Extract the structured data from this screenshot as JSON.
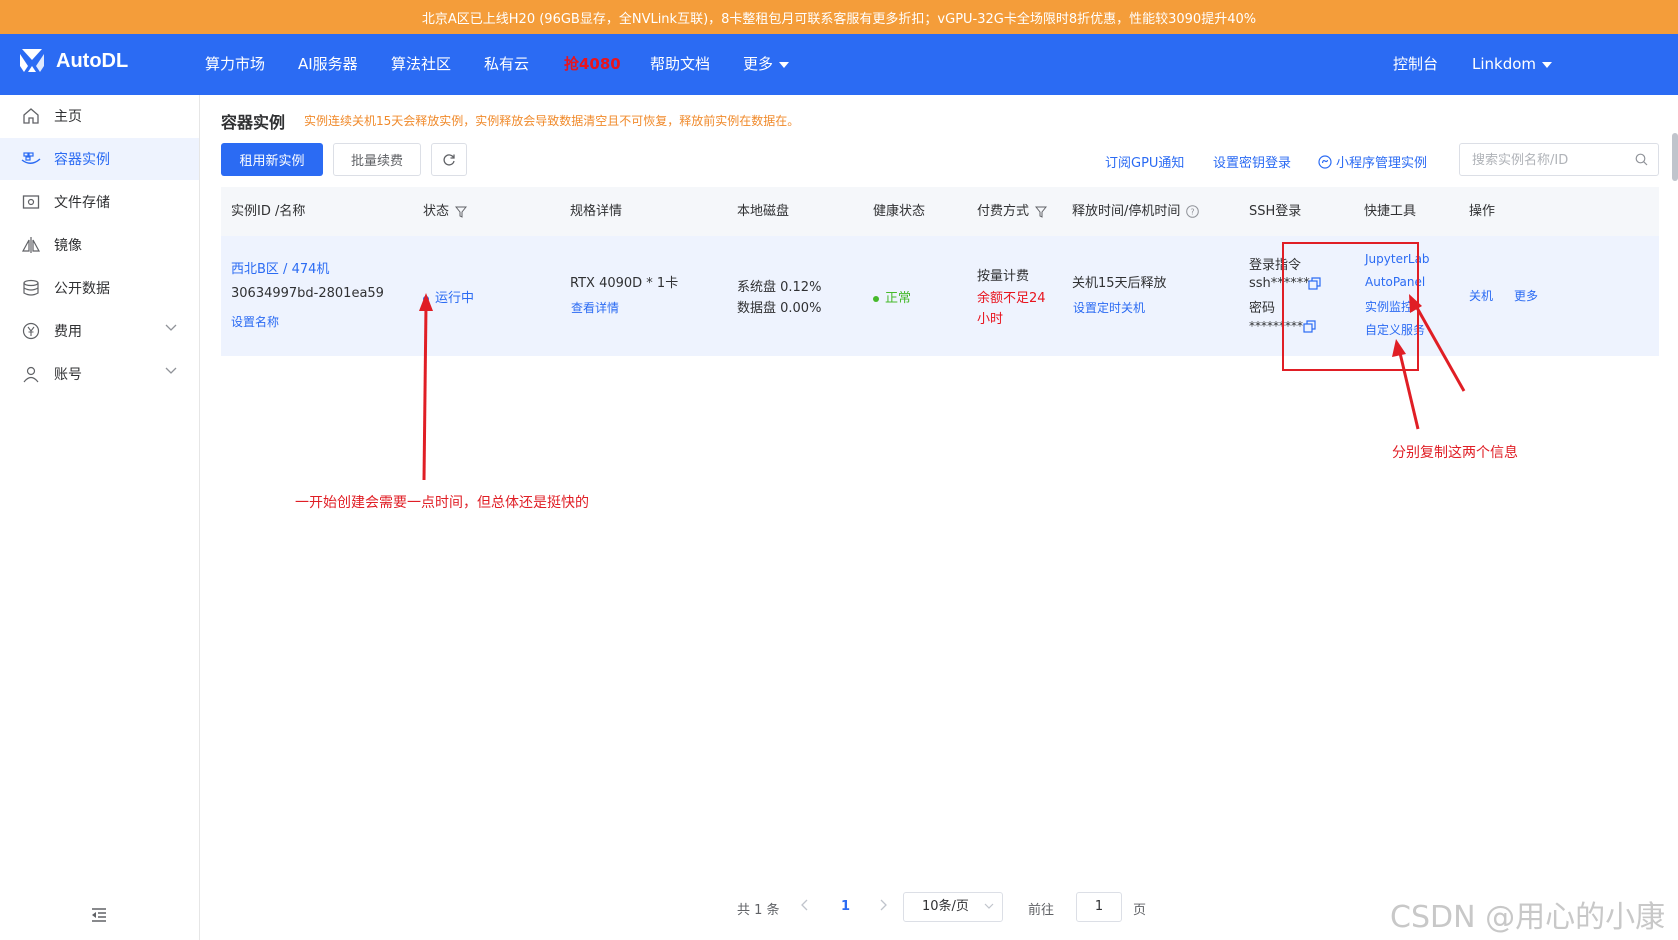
{
  "banner": {
    "text": "北京A区已上线H20 (96GB显存，全NVLink互联)，8卡整租包月可联系客服有更多折扣；vGPU-32G卡全场限时8折优惠，性能较3090提升40%"
  },
  "navbar": {
    "brand": "AutoDL",
    "items": [
      "算力市场",
      "AI服务器",
      "算法社区",
      "私有云",
      "抢4080",
      "帮助文档",
      "更多"
    ],
    "console": "控制台",
    "user": "Linkdom",
    "highlight_color": "#e8141e"
  },
  "sidebar": {
    "items": [
      {
        "label": "主页",
        "icon": "home-icon"
      },
      {
        "label": "容器实例",
        "icon": "container-icon"
      },
      {
        "label": "文件存储",
        "icon": "storage-icon"
      },
      {
        "label": "镜像",
        "icon": "image-icon"
      },
      {
        "label": "公开数据",
        "icon": "database-icon"
      },
      {
        "label": "费用",
        "icon": "yen-icon"
      },
      {
        "label": "账号",
        "icon": "user-icon"
      }
    ],
    "active_index": 1
  },
  "page": {
    "title": "容器实例",
    "warning": "实例连续关机15天会释放实例，实例释放会导致数据清空且不可恢复，释放前实例在数据在。"
  },
  "toolbar": {
    "rent_new": "租用新实例",
    "batch_renew": "批量续费",
    "subscribe_gpu": "订阅GPU通知",
    "set_key_login": "设置密钥登录",
    "mini_program": "小程序管理实例",
    "search_placeholder": "搜索实例名称/ID"
  },
  "table": {
    "headers": [
      "实例ID /名称",
      "状态",
      "规格详情",
      "本地磁盘",
      "健康状态",
      "付费方式",
      "释放时间/停机时间",
      "SSH登录",
      "快捷工具",
      "操作"
    ],
    "row": {
      "region": "西北B区 / 474机",
      "instance_id": "30634997bd-2801ea59",
      "set_name": "设置名称",
      "status": "运行中",
      "spec": "RTX 4090D * 1卡",
      "spec_detail": "查看详情",
      "disk_system": "系统盘 0.12%",
      "disk_data": "数据盘 0.00%",
      "health": "正常",
      "billing": "按量计费",
      "billing_warn_1": "余额不足24",
      "billing_warn_2": "小时",
      "release": "关机15天后释放",
      "set_timer": "设置定时关机",
      "ssh_cmd_label": "登录指令",
      "ssh_cmd": "ssh******",
      "ssh_pwd_label": "密码",
      "ssh_pwd": "*********",
      "tools": [
        "JupyterLab",
        "AutoPanel",
        "实例监控",
        "自定义服务"
      ],
      "actions": [
        "关机",
        "更多"
      ]
    }
  },
  "annotations": {
    "status_note": "一开始创建会需要一点时间，但总体还是挺快的",
    "copy_note": "分别复制这两个信息"
  },
  "pagination": {
    "total": "共 1 条",
    "current_page": "1",
    "page_size": "10条/页",
    "goto_prefix": "前往",
    "goto_value": "1",
    "goto_suffix": "页"
  },
  "watermark": "CSDN @用心的小康",
  "colors": {
    "primary": "#2b6bf3",
    "banner": "#f49d3a",
    "warning_text": "#f08a2b",
    "success": "#46b92b",
    "danger": "#e8141e",
    "annotation": "#e01e25"
  }
}
